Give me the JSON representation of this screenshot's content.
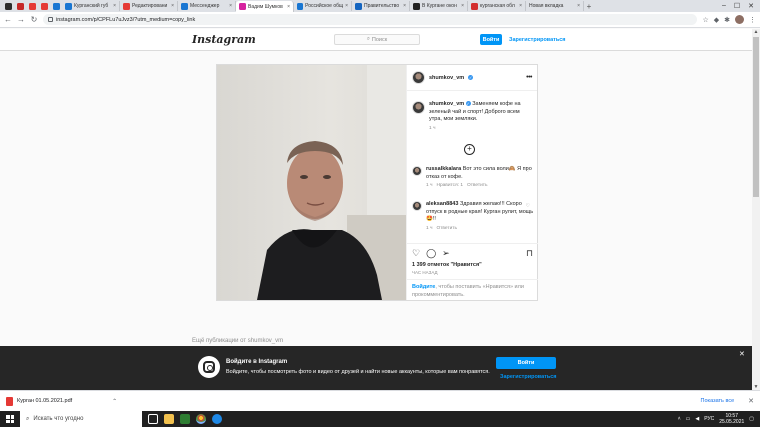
{
  "browser": {
    "tabs": [
      {
        "label": "",
        "color": "#2d2d2d"
      },
      {
        "label": "",
        "color": "#c62828"
      },
      {
        "label": "",
        "color": "#e53935"
      },
      {
        "label": "",
        "color": "#e53935"
      },
      {
        "label": "",
        "color": "#1976d2"
      },
      {
        "label": "Курганский губ",
        "color": "#1976d2"
      },
      {
        "label": "Редактировани",
        "color": "#e53935"
      },
      {
        "label": "Мессенджер",
        "color": "#1976d2"
      },
      {
        "label": "Вадим Шумков",
        "color": "#d6249f",
        "active": true
      },
      {
        "label": "Российское общ",
        "color": "#1976d2"
      },
      {
        "label": "Правительство",
        "color": "#1565c0"
      },
      {
        "label": "В Кургане окон",
        "color": "#212121"
      },
      {
        "label": "курганская обл",
        "color": "#d32f2f"
      },
      {
        "label": "Новая вкладка",
        "color": ""
      }
    ],
    "url": "instagram.com/p/CPFLu7uJvz3/?utm_medium=copy_link"
  },
  "instagram": {
    "logo": "Instagram",
    "search_placeholder": "Поиск",
    "login_label": "Войти",
    "register_label": "Зарегистрироваться"
  },
  "post": {
    "username": "shumkov_vm",
    "caption": {
      "username": "shumkov_vm",
      "text": "Заменяем кофе на зеленый чай и спорт! Доброго всем утра, мои земляки.",
      "time": "1 ч"
    },
    "comments": [
      {
        "username": "russalkkalara",
        "text": "Вот это сила воли🙈 Я про отказ от кофе.",
        "time": "1 ч",
        "likes": "Нравится: 1",
        "reply": "Ответить"
      },
      {
        "username": "aleksan8843",
        "text": "Здравия желаю!!! Скоро отпуск в родные края! Курган рулит, мощь🤩!!",
        "time": "1 ч",
        "reply": "Ответить"
      }
    ],
    "likes": "1 399 отметок \"Нравится\"",
    "posted": "ЧАС НАЗАД",
    "login_prompt_link": "Войдите",
    "login_prompt_text": ", чтобы поставить «Нравится» или прокомментировать."
  },
  "below_post_text": "Ещё публикации от shumkov_vm",
  "banner": {
    "title": "Войдите в Instagram",
    "subtitle": "Войдите, чтобы посмотреть фото и видео от друзей и найти новые аккаунты, которые вам понравятся.",
    "login_label": "Войти",
    "register_label": "Зарегистрироваться"
  },
  "downloads": {
    "file_name": "Курган 01.05.2021.pdf",
    "show_all": "Показать все"
  },
  "taskbar": {
    "search_placeholder": "Искать что угодно",
    "language": "РУС",
    "time": "10:57",
    "date": "25.05.2021"
  },
  "colors": {
    "ig_blue": "#0095f6",
    "banner_bg": "#262626"
  }
}
